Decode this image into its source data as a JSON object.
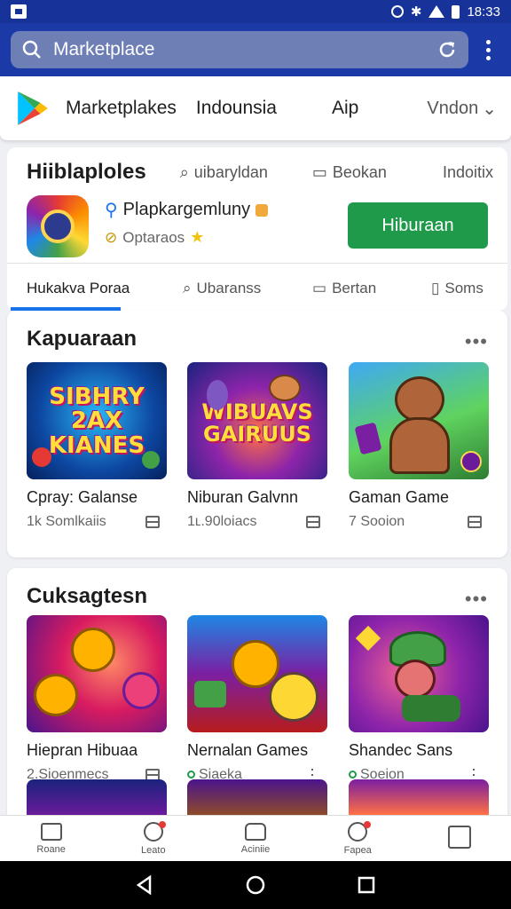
{
  "status_bar": {
    "time": "18:33"
  },
  "search": {
    "value": "Marketplace"
  },
  "top_tabs": {
    "items": [
      "Marketplakes",
      "Indounsia",
      "Aip"
    ],
    "dropdown": "Vndon"
  },
  "app_card": {
    "categories": [
      "Hiiblaploles",
      "uibaryldan",
      "Beokan",
      "Indoitix"
    ],
    "app_name": "Plapkargemluny",
    "app_sub": "Optaraos",
    "install_label": "Hiburaan",
    "sub_tabs": [
      "Hukakva Poraa",
      "Ubaranss",
      "Bertan",
      "Soms"
    ]
  },
  "section1": {
    "title": "Kapuaraan",
    "tiles": [
      {
        "name": "Cpray: Galanse",
        "sub": "1k Somlkaiis",
        "art": "SIBHRY 2AX KIANES"
      },
      {
        "name": "Niburan Galvnn",
        "sub": "1ʟ.90loiacs",
        "art": "WIBUAVS GAIRUUS"
      },
      {
        "name": "Gaman Game",
        "sub": "7 Sooion",
        "art": ""
      }
    ]
  },
  "section2": {
    "title": "Cuksagtesn",
    "tiles": [
      {
        "name": "Hiepran Hibuaa",
        "sub": "2.Sioenmecs"
      },
      {
        "name": "Nernalan Games",
        "sub": "Siaeka"
      },
      {
        "name": "Shandec Sans",
        "sub": "Soeion"
      }
    ]
  },
  "bottom_nav": [
    "Roane",
    "Leato",
    "Aciniie",
    "Fapea",
    ""
  ],
  "colors": {
    "brand": "#1b3aa8",
    "install": "#1f9a4b",
    "indicator": "#1a73e8"
  }
}
